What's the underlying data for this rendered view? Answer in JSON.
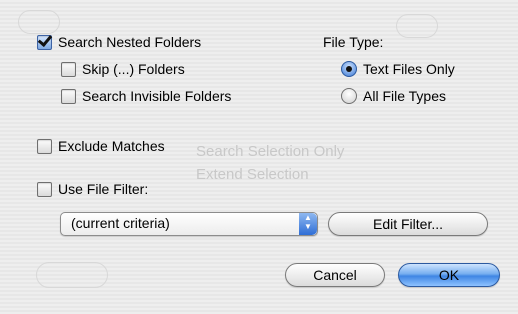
{
  "options": {
    "search_nested": {
      "label": "Search Nested Folders",
      "checked": true
    },
    "skip_folders": {
      "label": "Skip (...) Folders",
      "checked": false
    },
    "search_invisible": {
      "label": "Search Invisible Folders",
      "checked": false
    },
    "exclude_matches": {
      "label": "Exclude Matches",
      "checked": false
    },
    "use_file_filter": {
      "label": "Use File Filter:",
      "checked": false
    }
  },
  "file_type": {
    "heading": "File Type:",
    "options": [
      {
        "label": "Text Files Only",
        "selected": true
      },
      {
        "label": "All File Types",
        "selected": false
      }
    ]
  },
  "filter_popup": {
    "value": "(current criteria)"
  },
  "buttons": {
    "edit_filter": "Edit Filter...",
    "cancel": "Cancel",
    "ok": "OK"
  },
  "background_ghost": {
    "search_selection_only": "Search Selection Only",
    "extend_selection": "Extend Selection"
  }
}
